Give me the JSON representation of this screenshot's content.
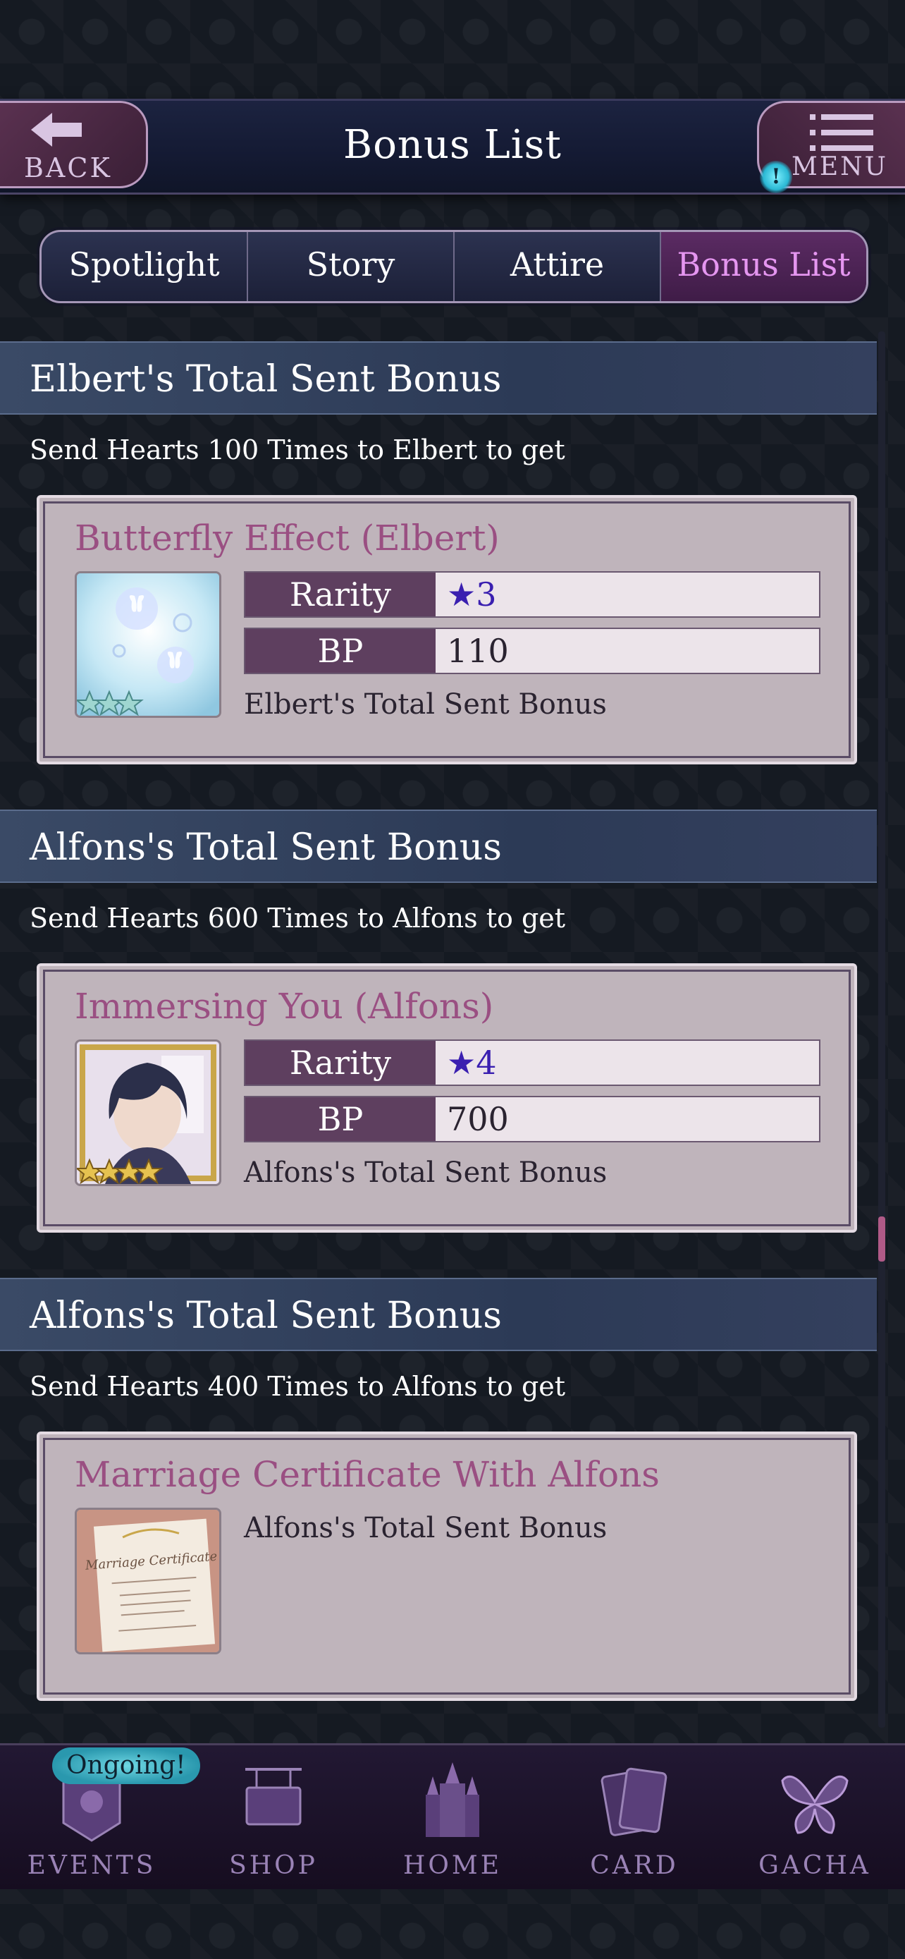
{
  "header": {
    "title": "Bonus List",
    "back_label": "BACK",
    "menu_label": "MENU",
    "menu_alert": "!"
  },
  "tabs": [
    {
      "label": "Spotlight",
      "active": false
    },
    {
      "label": "Story",
      "active": false
    },
    {
      "label": "Attire",
      "active": false
    },
    {
      "label": "Bonus List",
      "active": true
    }
  ],
  "sections": [
    {
      "title": "Elbert's Total Sent Bonus",
      "subtitle": "Send Hearts 100 Times to Elbert to get",
      "card": {
        "name": "Butterfly Effect (Elbert)",
        "rarity_key": "Rarity",
        "rarity_value": "★3",
        "bp_key": "BP",
        "bp_value": "110",
        "note": "Elbert's Total Sent Bonus",
        "thumb_icon": "butterfly-card-thumbnail",
        "thumb_stars": 3
      }
    },
    {
      "title": "Alfons's Total Sent Bonus",
      "subtitle": "Send Hearts 600 Times to Alfons to get",
      "card": {
        "name": "Immersing You (Alfons)",
        "rarity_key": "Rarity",
        "rarity_value": "★4",
        "bp_key": "BP",
        "bp_value": "700",
        "note": "Alfons's Total Sent Bonus",
        "thumb_icon": "alfons-portrait-thumbnail",
        "thumb_stars": 4
      }
    },
    {
      "title": "Alfons's Total Sent Bonus",
      "subtitle": "Send Hearts 400 Times to Alfons to get",
      "card": {
        "name": "Marriage Certificate With Alfons",
        "note": "Alfons's Total Sent Bonus",
        "thumb_icon": "marriage-certificate-thumbnail",
        "thumb_text": "Marriage Certificate"
      }
    }
  ],
  "bottom_nav": {
    "ongoing_badge": "Ongoing!",
    "items": [
      {
        "label": "EVENTS",
        "icon": "events-icon"
      },
      {
        "label": "SHOP",
        "icon": "shop-icon"
      },
      {
        "label": "HOME",
        "icon": "castle-icon"
      },
      {
        "label": "CARD",
        "icon": "card-icon"
      },
      {
        "label": "GACHA",
        "icon": "butterfly-icon"
      }
    ]
  },
  "colors": {
    "tab_active": "#e596f0",
    "card_title": "#9a4f82",
    "rarity_star": "#3a1fb0",
    "scroll_thumb": "#b05a87"
  }
}
